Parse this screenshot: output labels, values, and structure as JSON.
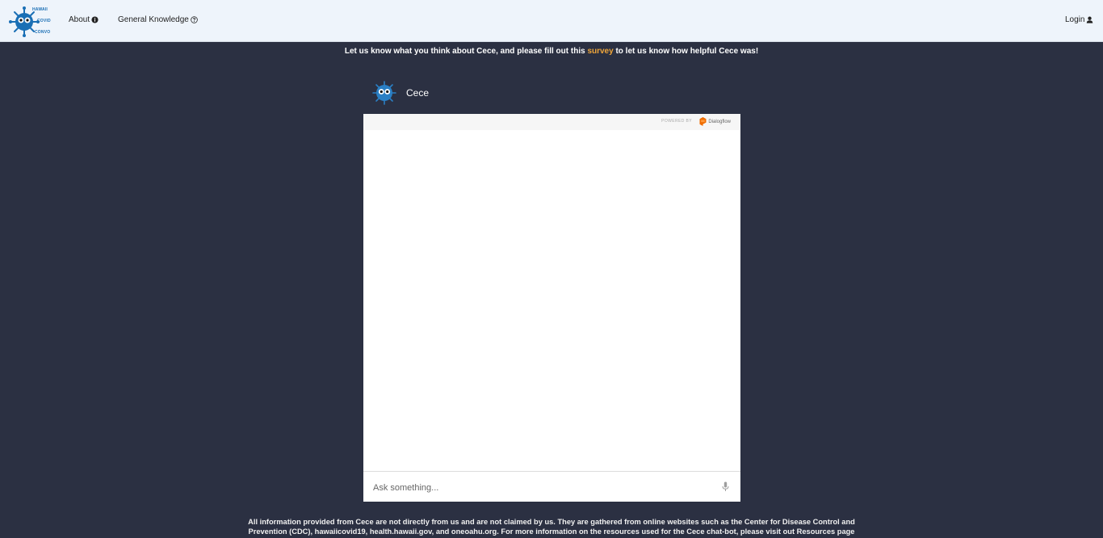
{
  "navbar": {
    "logo": {
      "line1": "HAWAII",
      "line2": "COVID",
      "line3": "CONVO",
      "icon": "virus-mascot-logo"
    },
    "about_label": "About",
    "general_knowledge_label": "General Knowledge",
    "login_label": "Login"
  },
  "survey": {
    "before": "Let us know what you think about Cece, and please fill out this ",
    "link": "survey",
    "after": " to let us know how helpful Cece was!"
  },
  "chat": {
    "agent_name": "Cece",
    "powered_by": "POWERED BY",
    "provider": "Dialogflow",
    "input_placeholder": "Ask something...",
    "input_value": ""
  },
  "footer": {
    "line1": "All information provided from Cece are not directly from us and are not claimed by us. They are gathered from online websites such as the Center for Disease Control and",
    "line2": "Prevention (CDC), hawaiicovid19, health.hawaii.gov, and oneoahu.org. For more information on the resources used for the Cece chat-bot, please visit out Resources page"
  },
  "colors": {
    "background": "#2b3042",
    "navbar": "#eef4fb",
    "survey_link": "#f0a63a",
    "logo_blue": "#1a6fb5"
  }
}
